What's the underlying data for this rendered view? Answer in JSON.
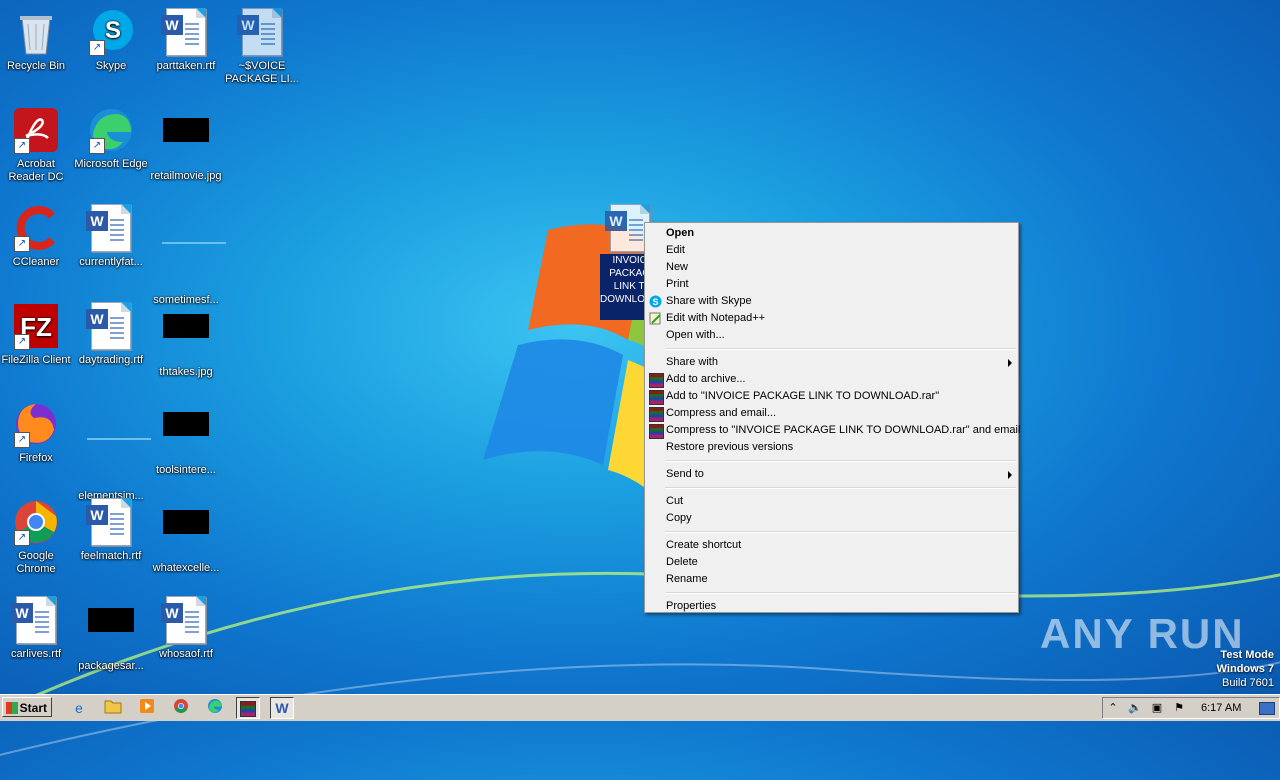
{
  "desktop": {
    "icons": [
      {
        "label": "Recycle Bin",
        "icon": "recycle-bin-icon"
      },
      {
        "label": "Skype",
        "icon": "skype-icon"
      },
      {
        "label": "parttaken.rtf",
        "icon": "word-document-icon"
      },
      {
        "label": "~$VOICE PACKAGE LI...",
        "icon": "word-document-icon"
      },
      {
        "label": "Acrobat Reader DC",
        "icon": "acrobat-icon"
      },
      {
        "label": "Microsoft Edge",
        "icon": "edge-icon"
      },
      {
        "label": "retailmovie.jpg",
        "icon": "image-thumbnail-icon"
      },
      {
        "label": "CCleaner",
        "icon": "ccleaner-icon"
      },
      {
        "label": "currentlyfat...",
        "icon": "word-document-icon"
      },
      {
        "label": "sometimesf...",
        "icon": "file-icon"
      },
      {
        "label": "FileZilla Client",
        "icon": "filezilla-icon"
      },
      {
        "label": "daytrading.rtf",
        "icon": "word-document-icon"
      },
      {
        "label": "thtakes.jpg",
        "icon": "image-thumbnail-icon"
      },
      {
        "label": "Firefox",
        "icon": "firefox-icon"
      },
      {
        "label": "elementsim...",
        "icon": "file-icon"
      },
      {
        "label": "toolsintere...",
        "icon": "image-thumbnail-icon"
      },
      {
        "label": "Google Chrome",
        "icon": "chrome-icon"
      },
      {
        "label": "feelmatch.rtf",
        "icon": "word-document-icon"
      },
      {
        "label": "whatexcelle...",
        "icon": "image-thumbnail-icon"
      },
      {
        "label": "carlives.rtf",
        "icon": "word-document-icon"
      },
      {
        "label": "packagesar...",
        "icon": "image-thumbnail-icon"
      },
      {
        "label": "whosaof.rtf",
        "icon": "word-document-icon"
      }
    ],
    "selected_icon_label": "INVOICE PACKAGE LINK TO DOWNLOAD.docm"
  },
  "context_menu": {
    "open": "Open",
    "edit": "Edit",
    "new": "New",
    "print": "Print",
    "share_skype": "Share with Skype",
    "edit_notepad": "Edit with Notepad++",
    "open_with": "Open with...",
    "share_with": "Share with",
    "add_archive": "Add to archive...",
    "add_rar": "Add to \"INVOICE PACKAGE LINK TO DOWNLOAD.rar\"",
    "compress_email": "Compress and email...",
    "compress_rar_email": "Compress to \"INVOICE PACKAGE LINK TO DOWNLOAD.rar\" and email",
    "restore": "Restore previous versions",
    "send_to": "Send to",
    "cut": "Cut",
    "copy": "Copy",
    "create_shortcut": "Create shortcut",
    "delete": "Delete",
    "rename": "Rename",
    "properties": "Properties"
  },
  "watermark": {
    "brand": "ANY RUN",
    "mode": "Test Mode",
    "os": "Windows 7",
    "build": "Build 7601"
  },
  "taskbar": {
    "start_label": "Start",
    "clock": "6:17 AM"
  }
}
